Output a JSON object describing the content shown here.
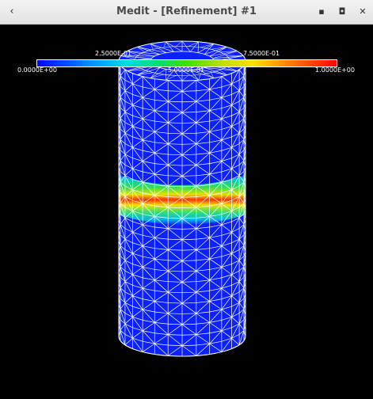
{
  "window": {
    "title": "Medit - [Refinement] #1",
    "back_icon": "chevron-left-icon",
    "controls": [
      "minimize-icon",
      "maximize-icon",
      "close-icon"
    ]
  },
  "colorbar": {
    "min_label": "0.0000E+00",
    "quarter_label": "2.5000E-01",
    "half_label": "5.0000E-01",
    "three_quarter_label": "7.5000E-01",
    "max_label": "1.0000E+00",
    "gradient": [
      "#0000ff",
      "#0090ff",
      "#00e0e0",
      "#00e070",
      "#40e000",
      "#c0e000",
      "#ffe000",
      "#ff8000",
      "#ff0000"
    ]
  },
  "mesh": {
    "base_color": "#0b22ff",
    "wire_color": "#ffffff",
    "background": "#000000"
  }
}
